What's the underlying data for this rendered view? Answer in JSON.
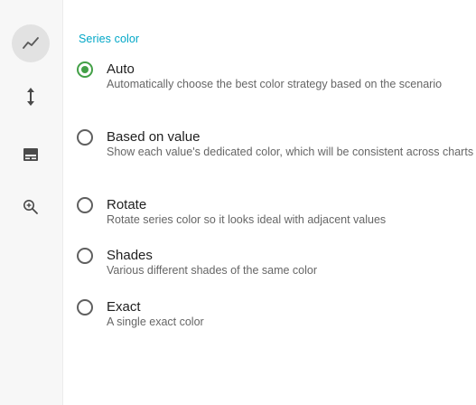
{
  "rail": {
    "items": [
      {
        "icon": "line-chart-icon",
        "active": true
      },
      {
        "icon": "vertical-resize-icon",
        "active": false
      },
      {
        "icon": "legend-icon",
        "active": false
      },
      {
        "icon": "zoom-in-icon",
        "active": false
      }
    ]
  },
  "series_color": {
    "title": "Series color",
    "selected": "Auto",
    "accent": "#00a7c7",
    "radio_color": "#43a047",
    "options": [
      {
        "label": "Auto",
        "description": "Automatically choose the best color strategy based on the scenario"
      },
      {
        "label": "Based on value",
        "description": "Show each value's dedicated color, which will be consistent across charts"
      },
      {
        "label": "Rotate",
        "description": "Rotate series color so it looks ideal with adjacent values"
      },
      {
        "label": "Shades",
        "description": "Various different shades of the same color"
      },
      {
        "label": "Exact",
        "description": "A single exact color"
      }
    ]
  }
}
